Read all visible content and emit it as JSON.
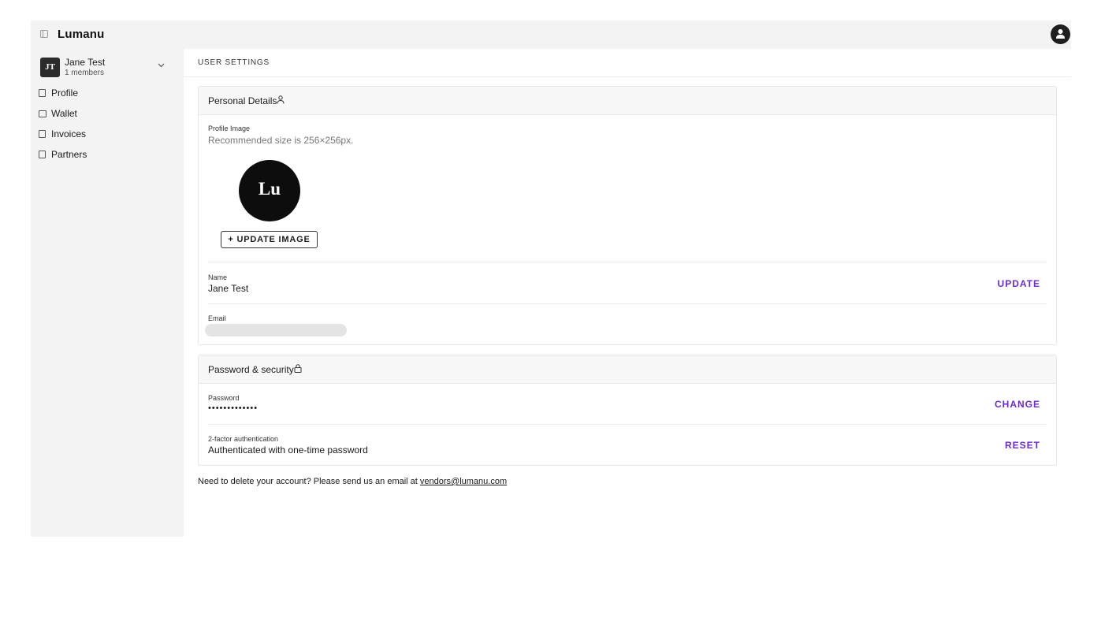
{
  "app": {
    "brand": "Lumanu"
  },
  "sidebar": {
    "org": {
      "initials": "JT",
      "name": "Jane Test",
      "members": "1 members"
    },
    "items": [
      {
        "label": "Profile",
        "icon": "profile-icon"
      },
      {
        "label": "Wallet",
        "icon": "wallet-icon"
      },
      {
        "label": "Invoices",
        "icon": "invoice-icon"
      },
      {
        "label": "Partners",
        "icon": "partners-icon"
      }
    ]
  },
  "main": {
    "title": "USER SETTINGS",
    "personal": {
      "title": "Personal Details",
      "profile_image_label": "Profile Image",
      "profile_image_help": "Recommended size is 256×256px.",
      "avatar_initials": "Lu",
      "update_image_label": "+ UPDATE IMAGE",
      "name_label": "Name",
      "name_value": "Jane Test",
      "name_action": "UPDATE",
      "email_label": "Email"
    },
    "security": {
      "title": "Password & security",
      "password_label": "Password",
      "password_value": "•••••••••••••",
      "password_action": "CHANGE",
      "twofa_label": "2-factor authentication",
      "twofa_value": "Authenticated with one-time password",
      "twofa_action": "RESET"
    },
    "footer": {
      "text": "Need to delete your account? Please send us an email at ",
      "email": "vendors@lumanu.com"
    }
  },
  "colors": {
    "accent": "#6b2bd6",
    "sidebar_bg": "#f3f3f3"
  }
}
